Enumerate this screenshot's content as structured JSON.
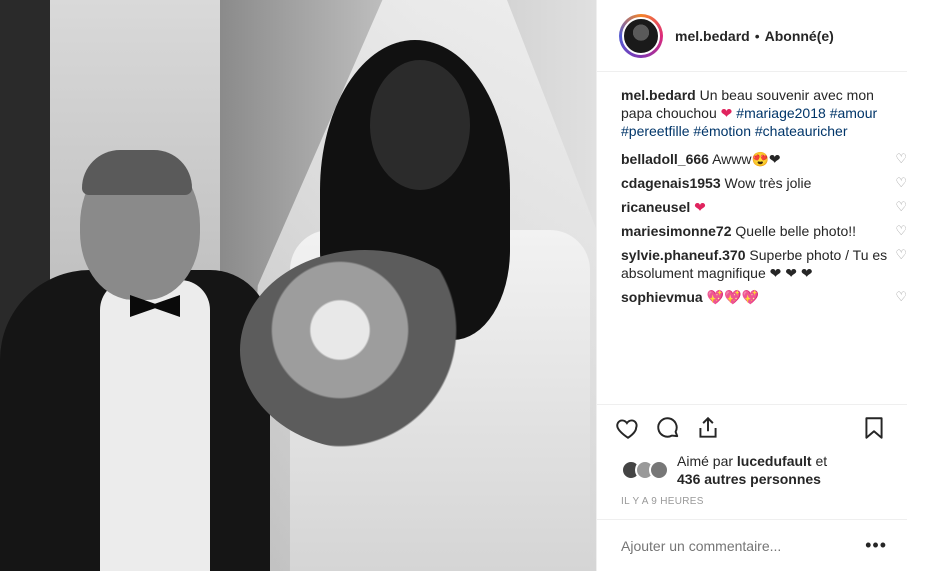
{
  "post": {
    "username": "mel.bedard",
    "follow_status": "Abonné(e)",
    "separator": "•"
  },
  "caption": {
    "user": "mel.bedard",
    "text": "Un beau souvenir avec mon papa chouchou",
    "emoji": "❤",
    "tags": [
      "#mariage2018",
      "#amour",
      "#pereetfille",
      "#émotion",
      "#chateauricher"
    ]
  },
  "comments": [
    {
      "user": "belladoll_666",
      "text": "Awww😍❤"
    },
    {
      "user": "cdagenais1953",
      "text": "Wow très jolie"
    },
    {
      "user": "ricaneusel",
      "text": "❤"
    },
    {
      "user": "mariesimonne72",
      "text": "Quelle belle photo!!"
    },
    {
      "user": "sylvie.phaneuf.370",
      "text": "Superbe photo / Tu es absolument magnifique ❤ ❤ ❤"
    },
    {
      "user": "sophievmua",
      "text": "💖💖💖"
    }
  ],
  "likes": {
    "prefix": "Aimé par",
    "user": "lucedufault",
    "conj": "et",
    "others": "436 autres personnes"
  },
  "timestamp": "IL Y A 9 HEURES",
  "add_comment": {
    "placeholder": "Ajouter un commentaire...",
    "more_label": "•••"
  },
  "icons": {
    "like": "heart-outline-icon",
    "comment": "comment-bubble-icon",
    "share": "share-icon",
    "save": "bookmark-icon",
    "comment_like": "small-heart-icon"
  }
}
